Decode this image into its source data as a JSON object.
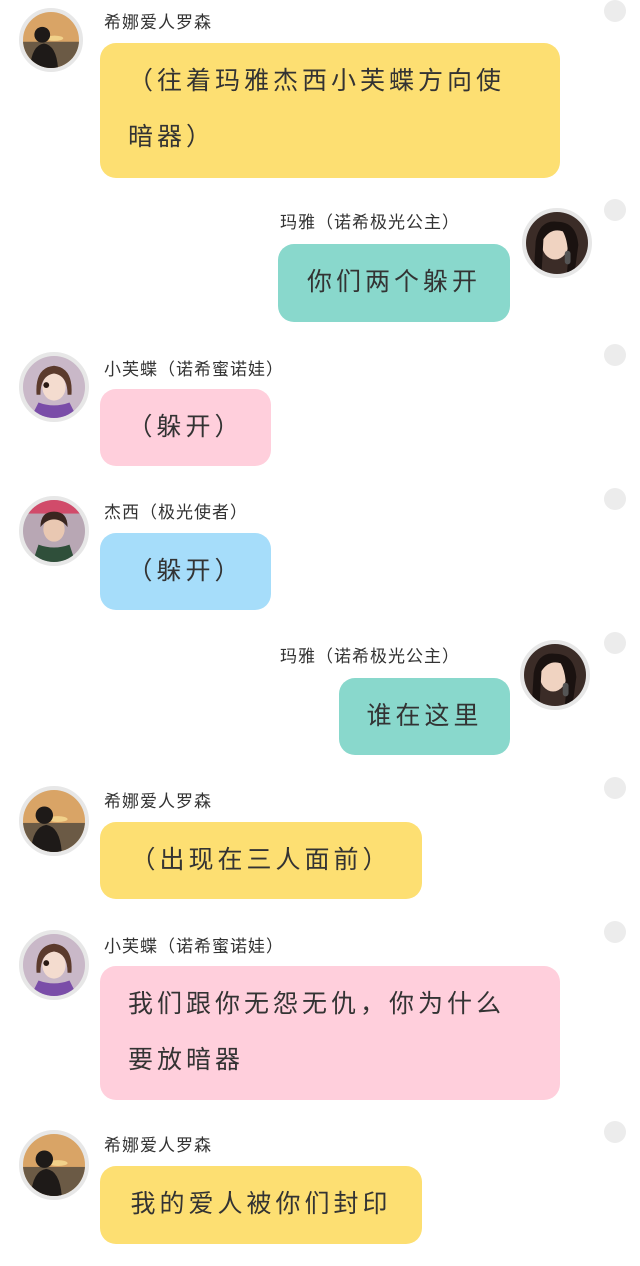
{
  "colors": {
    "yellow": "#fddf72",
    "teal": "#89d8cc",
    "pink": "#ffcfdc",
    "blue": "#a6ddfa",
    "dot": "#ececec"
  },
  "messages": [
    {
      "side": "left",
      "speaker": "希娜爱人罗森",
      "avatar": "rosen-avatar",
      "text": "（往着玛雅杰西小芙蝶方向使暗器）",
      "color": "yellow"
    },
    {
      "side": "right",
      "speaker": "玛雅（诺希极光公主）",
      "avatar": "maya-avatar",
      "text": "你们两个躲开",
      "color": "teal"
    },
    {
      "side": "left",
      "speaker": "小芙蝶（诺希蜜诺娃）",
      "avatar": "xiaofudie-avatar",
      "text": "（躲开）",
      "color": "pink"
    },
    {
      "side": "left",
      "speaker": "杰西（极光使者）",
      "avatar": "jiexi-avatar",
      "text": "（躲开）",
      "color": "blue"
    },
    {
      "side": "right",
      "speaker": "玛雅（诺希极光公主）",
      "avatar": "maya-avatar",
      "text": "谁在这里",
      "color": "teal"
    },
    {
      "side": "left",
      "speaker": "希娜爱人罗森",
      "avatar": "rosen-avatar",
      "text": "（出现在三人面前）",
      "color": "yellow"
    },
    {
      "side": "left",
      "speaker": "小芙蝶（诺希蜜诺娃）",
      "avatar": "xiaofudie-avatar",
      "text": "我们跟你无怨无仇，你为什么要放暗器",
      "color": "pink"
    },
    {
      "side": "left",
      "speaker": "希娜爱人罗森",
      "avatar": "rosen-avatar",
      "text": "我的爱人被你们封印",
      "color": "yellow"
    }
  ]
}
